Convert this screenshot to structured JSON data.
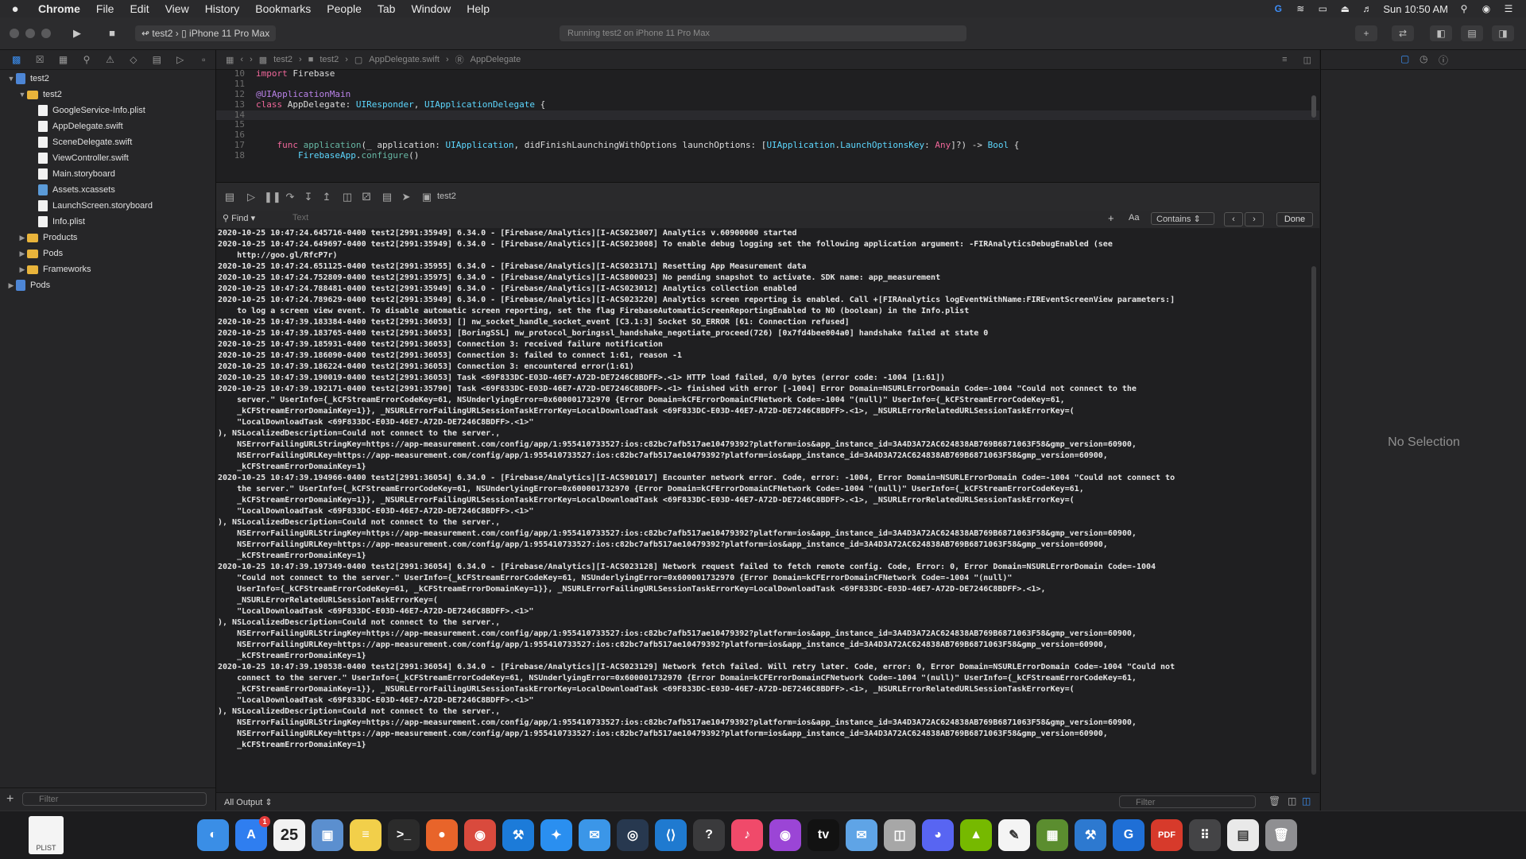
{
  "menubar": {
    "app": "Chrome",
    "items": [
      "File",
      "Edit",
      "View",
      "History",
      "Bookmarks",
      "People",
      "Tab",
      "Window",
      "Help"
    ],
    "clock": "Sun 10:50 AM"
  },
  "toolbar": {
    "scheme_target": "test2",
    "scheme_device": "iPhone 11 Pro Max",
    "activity": "Running test2 on iPhone 11 Pro Max"
  },
  "navigator": {
    "items": [
      {
        "label": "test2",
        "kind": "project",
        "indent": 0,
        "open": true
      },
      {
        "label": "test2",
        "kind": "folder",
        "indent": 1,
        "open": true
      },
      {
        "label": "GoogleService-Info.plist",
        "kind": "file",
        "indent": 2
      },
      {
        "label": "AppDelegate.swift",
        "kind": "file",
        "indent": 2
      },
      {
        "label": "SceneDelegate.swift",
        "kind": "file",
        "indent": 2
      },
      {
        "label": "ViewController.swift",
        "kind": "file",
        "indent": 2
      },
      {
        "label": "Main.storyboard",
        "kind": "file",
        "indent": 2
      },
      {
        "label": "Assets.xcassets",
        "kind": "asset",
        "indent": 2
      },
      {
        "label": "LaunchScreen.storyboard",
        "kind": "file",
        "indent": 2
      },
      {
        "label": "Info.plist",
        "kind": "file",
        "indent": 2
      },
      {
        "label": "Products",
        "kind": "folder",
        "indent": 1,
        "open": false
      },
      {
        "label": "Pods",
        "kind": "folder",
        "indent": 1,
        "open": false
      },
      {
        "label": "Frameworks",
        "kind": "folder",
        "indent": 1,
        "open": false
      },
      {
        "label": "Pods",
        "kind": "project",
        "indent": 0,
        "open": false
      }
    ],
    "filter_placeholder": "Filter"
  },
  "jumpbar": {
    "crumbs": [
      "test2",
      "test2",
      "AppDelegate.swift",
      "AppDelegate"
    ]
  },
  "code_lines": [
    {
      "n": "10",
      "parts": [
        [
          "kw",
          "import "
        ],
        [
          "pl",
          "Firebase"
        ]
      ]
    },
    {
      "n": "11",
      "parts": []
    },
    {
      "n": "12",
      "parts": [
        [
          "at",
          "@UIApplicationMain"
        ]
      ]
    },
    {
      "n": "13",
      "parts": [
        [
          "kw",
          "class "
        ],
        [
          "pl",
          "AppDelegate: "
        ],
        [
          "ty",
          "UIResponder"
        ],
        [
          "pl",
          ", "
        ],
        [
          "ty",
          "UIApplicationDelegate"
        ],
        [
          "pl",
          " {"
        ]
      ]
    },
    {
      "n": "14",
      "parts": [],
      "current": true
    },
    {
      "n": "15",
      "parts": []
    },
    {
      "n": "16",
      "parts": []
    },
    {
      "n": "17",
      "parts": [
        [
          "pl",
          "    "
        ],
        [
          "kw",
          "func "
        ],
        [
          "fn",
          "application"
        ],
        [
          "pl",
          "(_ application: "
        ],
        [
          "ty",
          "UIApplication"
        ],
        [
          "pl",
          ", didFinishLaunchingWithOptions launchOptions: ["
        ],
        [
          "ty",
          "UIApplication"
        ],
        [
          "pl",
          "."
        ],
        [
          "ty",
          "LaunchOptionsKey"
        ],
        [
          "pl",
          ": "
        ],
        [
          "kw",
          "Any"
        ],
        [
          "pl",
          "]?) -> "
        ],
        [
          "ty",
          "Bool"
        ],
        [
          "pl",
          " {"
        ]
      ]
    },
    {
      "n": "18",
      "parts": [
        [
          "pl",
          "        "
        ],
        [
          "ty",
          "FirebaseApp"
        ],
        [
          "pl",
          "."
        ],
        [
          "fn",
          "configure"
        ],
        [
          "pl",
          "()"
        ]
      ]
    }
  ],
  "debugbar": {
    "process": "test2"
  },
  "findbar": {
    "mode": "Find",
    "placeholder": "Text",
    "case": "Aa",
    "match": "Contains",
    "done": "Done"
  },
  "console_lines": [
    "2020-10-25 10:47:24.645716-0400 test2[2991:35949] 6.34.0 - [Firebase/Analytics][I-ACS023007] Analytics v.60900000 started",
    "2020-10-25 10:47:24.649697-0400 test2[2991:35949] 6.34.0 - [Firebase/Analytics][I-ACS023008] To enable debug logging set the following application argument: -FIRAnalyticsDebugEnabled (see",
    "    http://goo.gl/RfcP7r)",
    "2020-10-25 10:47:24.651125-0400 test2[2991:35955] 6.34.0 - [Firebase/Analytics][I-ACS023171] Resetting App Measurement data",
    "2020-10-25 10:47:24.752809-0400 test2[2991:35975] 6.34.0 - [Firebase/Analytics][I-ACS800023] No pending snapshot to activate. SDK name: app_measurement",
    "2020-10-25 10:47:24.788481-0400 test2[2991:35949] 6.34.0 - [Firebase/Analytics][I-ACS023012] Analytics collection enabled",
    "2020-10-25 10:47:24.789629-0400 test2[2991:35949] 6.34.0 - [Firebase/Analytics][I-ACS023220] Analytics screen reporting is enabled. Call +[FIRAnalytics logEventWithName:FIREventScreenView parameters:]",
    "    to log a screen view event. To disable automatic screen reporting, set the flag FirebaseAutomaticScreenReportingEnabled to NO (boolean) in the Info.plist",
    "2020-10-25 10:47:39.183384-0400 test2[2991:36053] [] nw_socket_handle_socket_event [C3.1:3] Socket SO_ERROR [61: Connection refused]",
    "2020-10-25 10:47:39.183765-0400 test2[2991:36053] [BoringSSL] nw_protocol_boringssl_handshake_negotiate_proceed(726) [0x7fd4bee004a0] handshake failed at state 0",
    "2020-10-25 10:47:39.185931-0400 test2[2991:36053] Connection 3: received failure notification",
    "2020-10-25 10:47:39.186090-0400 test2[2991:36053] Connection 3: failed to connect 1:61, reason -1",
    "2020-10-25 10:47:39.186224-0400 test2[2991:36053] Connection 3: encountered error(1:61)",
    "2020-10-25 10:47:39.190019-0400 test2[2991:36053] Task <69F833DC-E03D-46E7-A72D-DE7246C8BDFF>.<1> HTTP load failed, 0/0 bytes (error code: -1004 [1:61])",
    "2020-10-25 10:47:39.192171-0400 test2[2991:35790] Task <69F833DC-E03D-46E7-A72D-DE7246C8BDFF>.<1> finished with error [-1004] Error Domain=NSURLErrorDomain Code=-1004 \"Could not connect to the",
    "    server.\" UserInfo={_kCFStreamErrorCodeKey=61, NSUnderlyingError=0x600001732970 {Error Domain=kCFErrorDomainCFNetwork Code=-1004 \"(null)\" UserInfo={_kCFStreamErrorCodeKey=61,",
    "    _kCFStreamErrorDomainKey=1}}, _NSURLErrorFailingURLSessionTaskErrorKey=LocalDownloadTask <69F833DC-E03D-46E7-A72D-DE7246C8BDFF>.<1>, _NSURLErrorRelatedURLSessionTaskErrorKey=(",
    "    \"LocalDownloadTask <69F833DC-E03D-46E7-A72D-DE7246C8BDFF>.<1>\"",
    "), NSLocalizedDescription=Could not connect to the server.,",
    "    NSErrorFailingURLStringKey=https://app-measurement.com/config/app/1:955410733527:ios:c82bc7afb517ae10479392?platform=ios&app_instance_id=3A4D3A72AC624838AB769B6871063F58&gmp_version=60900,",
    "    NSErrorFailingURLKey=https://app-measurement.com/config/app/1:955410733527:ios:c82bc7afb517ae10479392?platform=ios&app_instance_id=3A4D3A72AC624838AB769B6871063F58&gmp_version=60900,",
    "    _kCFStreamErrorDomainKey=1}",
    "2020-10-25 10:47:39.194966-0400 test2[2991:36054] 6.34.0 - [Firebase/Analytics][I-ACS901017] Encounter network error. Code, error: -1004, Error Domain=NSURLErrorDomain Code=-1004 \"Could not connect to",
    "    the server.\" UserInfo={_kCFStreamErrorCodeKey=61, NSUnderlyingError=0x600001732970 {Error Domain=kCFErrorDomainCFNetwork Code=-1004 \"(null)\" UserInfo={_kCFStreamErrorCodeKey=61,",
    "    _kCFStreamErrorDomainKey=1}}, _NSURLErrorFailingURLSessionTaskErrorKey=LocalDownloadTask <69F833DC-E03D-46E7-A72D-DE7246C8BDFF>.<1>, _NSURLErrorRelatedURLSessionTaskErrorKey=(",
    "    \"LocalDownloadTask <69F833DC-E03D-46E7-A72D-DE7246C8BDFF>.<1>\"",
    "), NSLocalizedDescription=Could not connect to the server.,",
    "    NSErrorFailingURLStringKey=https://app-measurement.com/config/app/1:955410733527:ios:c82bc7afb517ae10479392?platform=ios&app_instance_id=3A4D3A72AC624838AB769B6871063F58&gmp_version=60900,",
    "    NSErrorFailingURLKey=https://app-measurement.com/config/app/1:955410733527:ios:c82bc7afb517ae10479392?platform=ios&app_instance_id=3A4D3A72AC624838AB769B6871063F58&gmp_version=60900,",
    "    _kCFStreamErrorDomainKey=1}",
    "2020-10-25 10:47:39.197349-0400 test2[2991:36054] 6.34.0 - [Firebase/Analytics][I-ACS023128] Network request failed to fetch remote config. Code, Error: 0, Error Domain=NSURLErrorDomain Code=-1004",
    "    \"Could not connect to the server.\" UserInfo={_kCFStreamErrorCodeKey=61, NSUnderlyingError=0x600001732970 {Error Domain=kCFErrorDomainCFNetwork Code=-1004 \"(null)\"",
    "    UserInfo={_kCFStreamErrorCodeKey=61, _kCFStreamErrorDomainKey=1}}, _NSURLErrorFailingURLSessionTaskErrorKey=LocalDownloadTask <69F833DC-E03D-46E7-A72D-DE7246C8BDFF>.<1>,",
    "    _NSURLErrorRelatedURLSessionTaskErrorKey=(",
    "    \"LocalDownloadTask <69F833DC-E03D-46E7-A72D-DE7246C8BDFF>.<1>\"",
    "), NSLocalizedDescription=Could not connect to the server.,",
    "    NSErrorFailingURLStringKey=https://app-measurement.com/config/app/1:955410733527:ios:c82bc7afb517ae10479392?platform=ios&app_instance_id=3A4D3A72AC624838AB769B6871063F58&gmp_version=60900,",
    "    NSErrorFailingURLKey=https://app-measurement.com/config/app/1:955410733527:ios:c82bc7afb517ae10479392?platform=ios&app_instance_id=3A4D3A72AC624838AB769B6871063F58&gmp_version=60900,",
    "    _kCFStreamErrorDomainKey=1}",
    "2020-10-25 10:47:39.198538-0400 test2[2991:36054] 6.34.0 - [Firebase/Analytics][I-ACS023129] Network fetch failed. Will retry later. Code, error: 0, Error Domain=NSURLErrorDomain Code=-1004 \"Could not",
    "    connect to the server.\" UserInfo={_kCFStreamErrorCodeKey=61, NSUnderlyingError=0x600001732970 {Error Domain=kCFErrorDomainCFNetwork Code=-1004 \"(null)\" UserInfo={_kCFStreamErrorCodeKey=61,",
    "    _kCFStreamErrorDomainKey=1}}, _NSURLErrorFailingURLSessionTaskErrorKey=LocalDownloadTask <69F833DC-E03D-46E7-A72D-DE7246C8BDFF>.<1>, _NSURLErrorRelatedURLSessionTaskErrorKey=(",
    "    \"LocalDownloadTask <69F833DC-E03D-46E7-A72D-DE7246C8BDFF>.<1>\"",
    "), NSLocalizedDescription=Could not connect to the server.,",
    "    NSErrorFailingURLStringKey=https://app-measurement.com/config/app/1:955410733527:ios:c82bc7afb517ae10479392?platform=ios&app_instance_id=3A4D3A72AC624838AB769B6871063F58&gmp_version=60900,",
    "    NSErrorFailingURLKey=https://app-measurement.com/config/app/1:955410733527:ios:c82bc7afb517ae10479392?platform=ios&app_instance_id=3A4D3A72AC624838AB769B6871063F58&gmp_version=60900,",
    "    _kCFStreamErrorDomainKey=1}"
  ],
  "console_footer": {
    "output_mode": "All Output",
    "filter_placeholder": "Filter"
  },
  "inspector": {
    "empty_state": "No Selection"
  },
  "dock": {
    "recent_doc_label": "PLIST",
    "calendar_day": "25",
    "app_store_badge": "1",
    "apps": [
      {
        "icon": "finder-icon",
        "color": "#3a8ee6",
        "glyph": "◐"
      },
      {
        "icon": "app-store-icon",
        "color": "#2f7ef0",
        "glyph": "A",
        "badge": true
      },
      {
        "icon": "calendar-icon",
        "color": "#f2f2f2",
        "glyph": "",
        "calendar": true
      },
      {
        "icon": "preview-icon",
        "color": "#5b8fcf",
        "glyph": "▣"
      },
      {
        "icon": "notes-icon",
        "color": "#f2cf4a",
        "glyph": "≡"
      },
      {
        "icon": "terminal-icon",
        "color": "#2b2b2b",
        "glyph": ">_"
      },
      {
        "icon": "firefox-icon",
        "color": "#e8642a",
        "glyph": "●"
      },
      {
        "icon": "chrome-icon",
        "color": "#d94a3d",
        "glyph": "◉"
      },
      {
        "icon": "xcode-icon",
        "color": "#1c7bd9",
        "glyph": "⚒"
      },
      {
        "icon": "safari-icon",
        "color": "#2a8ff0",
        "glyph": "✦"
      },
      {
        "icon": "messages-icon",
        "color": "#3b96e8",
        "glyph": "✉"
      },
      {
        "icon": "steam-icon",
        "color": "#27384f",
        "glyph": "◎"
      },
      {
        "icon": "vscode-icon",
        "color": "#1f7ad0",
        "glyph": "⟨⟩"
      },
      {
        "icon": "help-icon",
        "color": "#3a3a3c",
        "glyph": "?"
      },
      {
        "icon": "music-icon",
        "color": "#f04a6a",
        "glyph": "♪"
      },
      {
        "icon": "podcasts-icon",
        "color": "#9b45d6",
        "glyph": "◉"
      },
      {
        "icon": "apple-tv-icon",
        "color": "#121212",
        "glyph": "tv"
      },
      {
        "icon": "mail-icon",
        "color": "#5fa4e6",
        "glyph": "✉"
      },
      {
        "icon": "disk-utility-icon",
        "color": "#a7a7a7",
        "glyph": "◫"
      },
      {
        "icon": "discord-icon",
        "color": "#5865f2",
        "glyph": "◕"
      },
      {
        "icon": "nvidia-icon",
        "color": "#76b900",
        "glyph": "▲"
      },
      {
        "icon": "textedit-icon",
        "color": "#f4f4f4",
        "glyph": "✎"
      },
      {
        "icon": "minecraft-icon",
        "color": "#5b8d2f",
        "glyph": "▦"
      },
      {
        "icon": "xcode-tools-icon",
        "color": "#2d79d0",
        "glyph": "⚒"
      },
      {
        "icon": "google-icon",
        "color": "#1f6fd6",
        "glyph": "G"
      },
      {
        "icon": "pdf-icon",
        "color": "#d73a2b",
        "glyph": "PDF"
      },
      {
        "icon": "mission-control-icon",
        "color": "#444446",
        "glyph": "⠿"
      },
      {
        "icon": "file-browser-icon",
        "color": "#e9e9e9",
        "glyph": "▤"
      },
      {
        "icon": "trash-icon",
        "color": "#8f8f92",
        "glyph": "🗑"
      }
    ]
  }
}
